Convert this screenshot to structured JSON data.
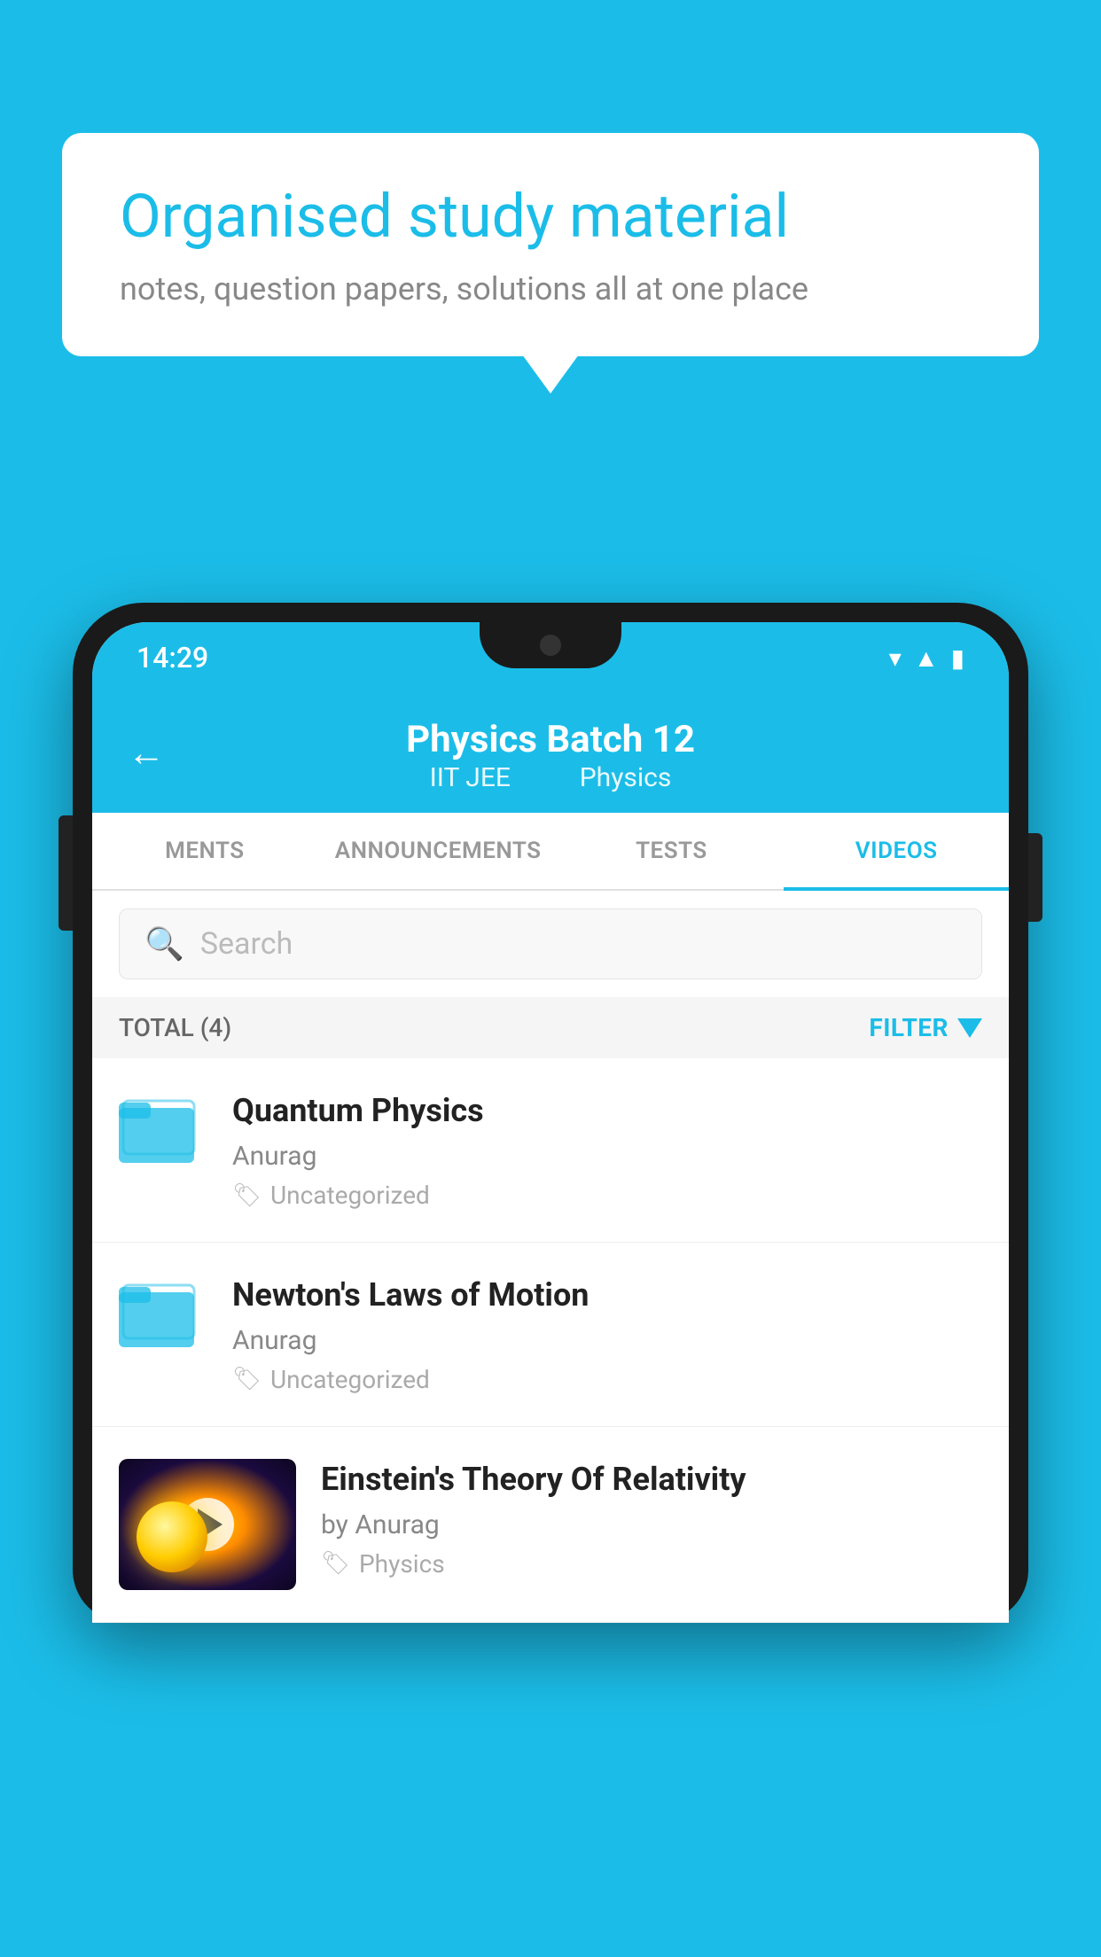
{
  "background_color": "#1BBDE8",
  "speech_bubble": {
    "title": "Organised study material",
    "subtitle": "notes, question papers, solutions all at one place"
  },
  "phone": {
    "status_bar": {
      "time": "14:29",
      "icons": [
        "wifi",
        "signal",
        "battery"
      ]
    },
    "header": {
      "back_label": "←",
      "title": "Physics Batch 12",
      "subtitle_part1": "IIT JEE",
      "subtitle_part2": "Physics"
    },
    "tabs": [
      {
        "label": "MENTS",
        "active": false
      },
      {
        "label": "ANNOUNCEMENTS",
        "active": false
      },
      {
        "label": "TESTS",
        "active": false
      },
      {
        "label": "VIDEOS",
        "active": true
      }
    ],
    "search": {
      "placeholder": "Search"
    },
    "filter_bar": {
      "total_label": "TOTAL (4)",
      "filter_label": "FILTER"
    },
    "videos": [
      {
        "id": 1,
        "title": "Quantum Physics",
        "author": "Anurag",
        "tag": "Uncategorized",
        "type": "folder"
      },
      {
        "id": 2,
        "title": "Newton's Laws of Motion",
        "author": "Anurag",
        "tag": "Uncategorized",
        "type": "folder"
      },
      {
        "id": 3,
        "title": "Einstein's Theory Of Relativity",
        "author": "by Anurag",
        "tag": "Physics",
        "type": "video"
      }
    ]
  }
}
